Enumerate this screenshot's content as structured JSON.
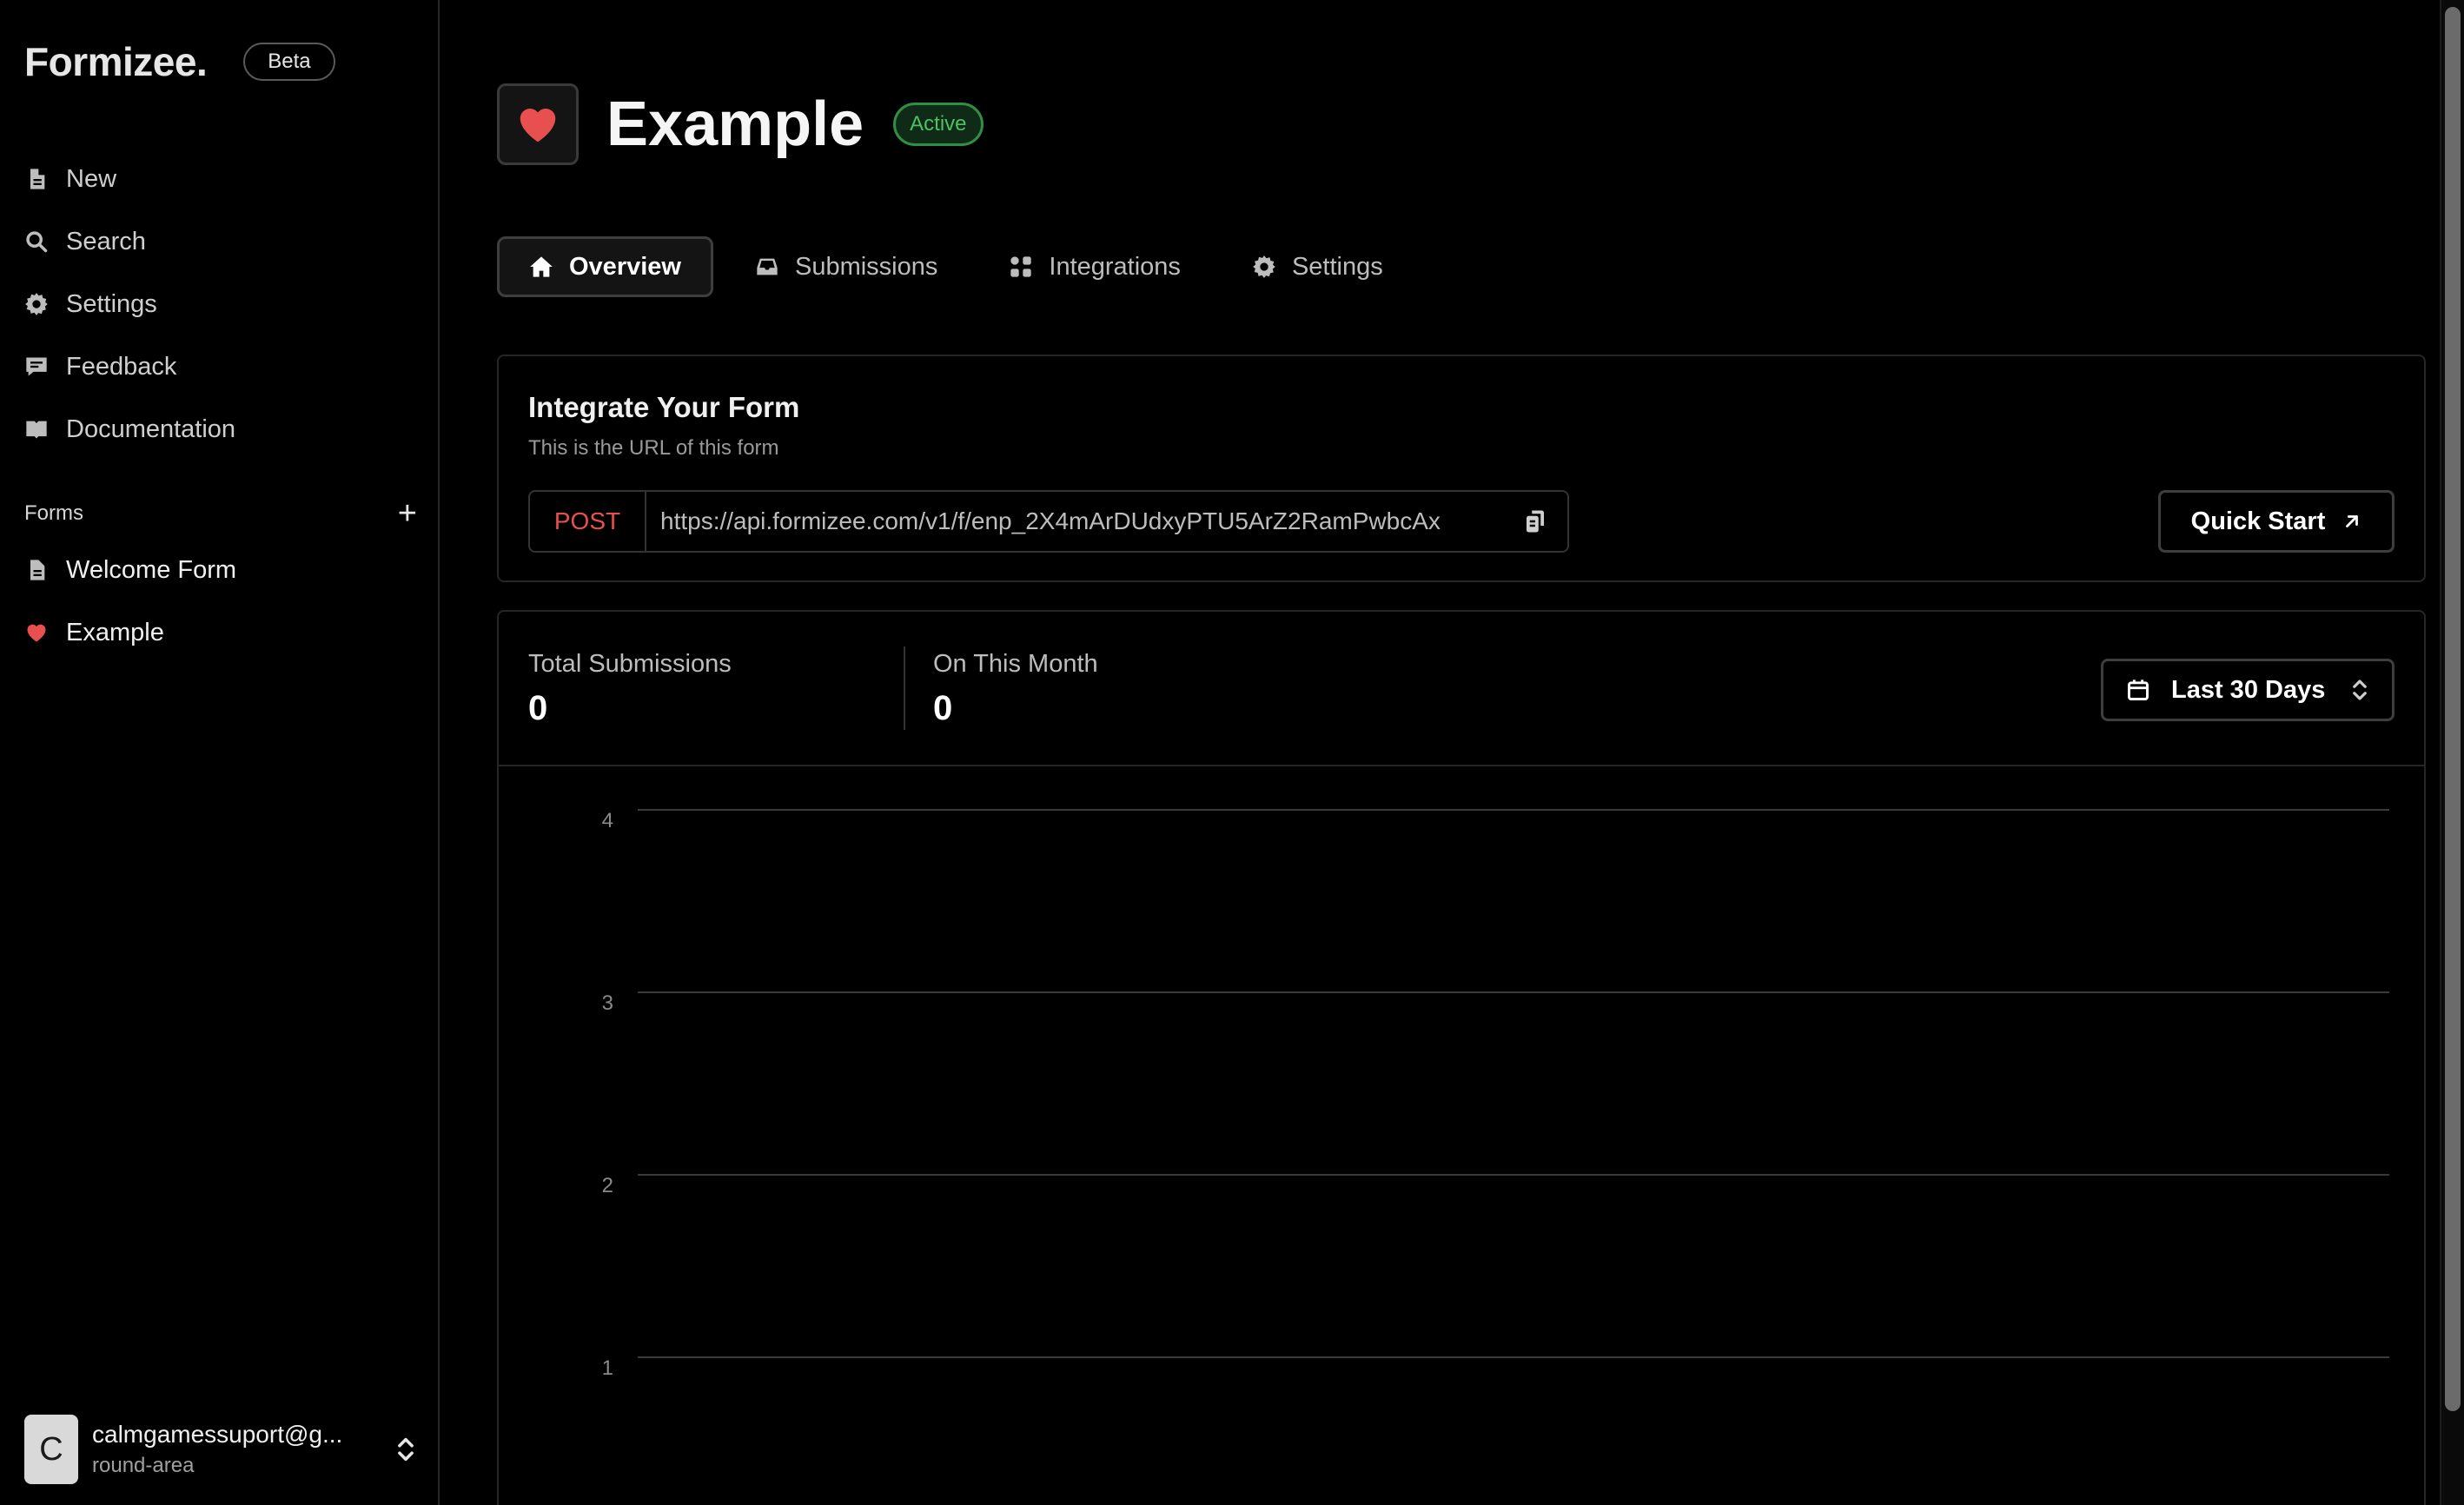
{
  "brand": {
    "name": "Formizee.",
    "badge": "Beta"
  },
  "nav": [
    {
      "label": "New",
      "icon": "document-icon"
    },
    {
      "label": "Search",
      "icon": "search-icon"
    },
    {
      "label": "Settings",
      "icon": "gear-icon"
    },
    {
      "label": "Feedback",
      "icon": "chat-icon"
    },
    {
      "label": "Documentation",
      "icon": "book-icon"
    }
  ],
  "forms_section": {
    "title": "Forms",
    "add": "+"
  },
  "forms": [
    {
      "label": "Welcome Form",
      "icon": "document-icon"
    },
    {
      "label": "Example",
      "icon": "heart-icon"
    }
  ],
  "user": {
    "initial": "C",
    "email": "calmgamessuport@g...",
    "team": "round-area"
  },
  "header": {
    "title": "Example",
    "status": "Active"
  },
  "tabs": [
    {
      "label": "Overview",
      "icon": "home-icon",
      "active": true
    },
    {
      "label": "Submissions",
      "icon": "inbox-icon",
      "active": false
    },
    {
      "label": "Integrations",
      "icon": "grid-icon",
      "active": false
    },
    {
      "label": "Settings",
      "icon": "gear-icon",
      "active": false
    }
  ],
  "integrate": {
    "title": "Integrate Your Form",
    "subtitle": "This is the URL of this form",
    "method": "POST",
    "url": "https://api.formizee.com/v1/f/enp_2X4mArDUdxyPTU5ArZ2RamPwbcAx",
    "quick_start": "Quick Start"
  },
  "stats": {
    "total_label": "Total Submissions",
    "total_value": "0",
    "month_label": "On This Month",
    "month_value": "0",
    "range": "Last 30 Days"
  },
  "chart_data": {
    "type": "line",
    "y_ticks": [
      4,
      3,
      2,
      1
    ],
    "series": [],
    "grid": true
  },
  "colors": {
    "accent_red": "#e8504f",
    "active_green": "#4ec064"
  }
}
